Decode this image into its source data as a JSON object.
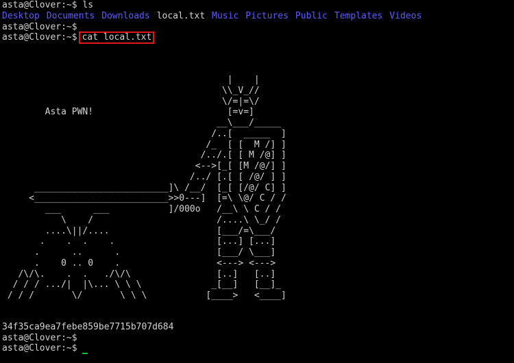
{
  "terminal": {
    "prompt": "asta@Clover:~$",
    "first_command": " ls",
    "listing": [
      {
        "name": "Desktop",
        "kind": "dir"
      },
      {
        "name": "Documents",
        "kind": "dir"
      },
      {
        "name": "Downloads",
        "kind": "dir"
      },
      {
        "name": "local.txt",
        "kind": "file"
      },
      {
        "name": "Music",
        "kind": "dir"
      },
      {
        "name": "Pictures",
        "kind": "dir"
      },
      {
        "name": "Public",
        "kind": "dir"
      },
      {
        "name": "Templates",
        "kind": "dir"
      },
      {
        "name": "Videos",
        "kind": "dir"
      }
    ],
    "highlighted_command": "cat local.txt",
    "ascii_art": "                                          |    |\n                                         \\\\_V_//\n                                         \\/=|=\\/\n        Asta PWN!                         [=v=]\n                                        __\\___/_____\n                                       /..[  _____  ]\n                                      /_  [ [  M /] ]\n                                     /../.[ [ M /@] ]\n                                    <-->[_[ [M /@/] ]\n                                   /../ [.[ [ /@/ ] ]\n      _________________________]\\ /__/  [_[ [/@/ C] ]\n     <_________________________>>0---]  [=\\ \\@/ C / /\n        ___      ___           ]/000o   /__\\ \\ C / /\n           \\    /                       /....\\ \\_/ /\n        ....\\||/....                    [___/=\\___/\n       .    .  .    .                   [...] [...]\n      .      ..      .                  [___/ \\___]\n      .    0 .. 0    .                  <---> <--->\n   /\\/\\.    .  .   ./\\/\\                [..]   [..]\n  / / / .../|  |\\... \\ \\ \\             _[__]   [__]_\n / / /       \\/       \\ \\ \\           [____>   <____]",
    "flag": "34f35ca9ea7febe859be7715b707d684"
  }
}
